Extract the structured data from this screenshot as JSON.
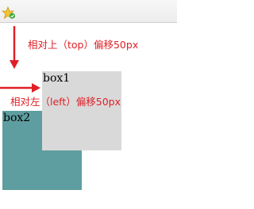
{
  "toolbar": {
    "favicon_icon": "star-icon"
  },
  "box1": {
    "label": "box1",
    "color": "#d9d9d9"
  },
  "box2": {
    "label": "box2",
    "color": "#5f9ea0"
  },
  "annotations": {
    "top_offset": "相对上（top）偏移50px",
    "left_offset": "相对左（left）偏移50px",
    "color": "#e01f26"
  }
}
